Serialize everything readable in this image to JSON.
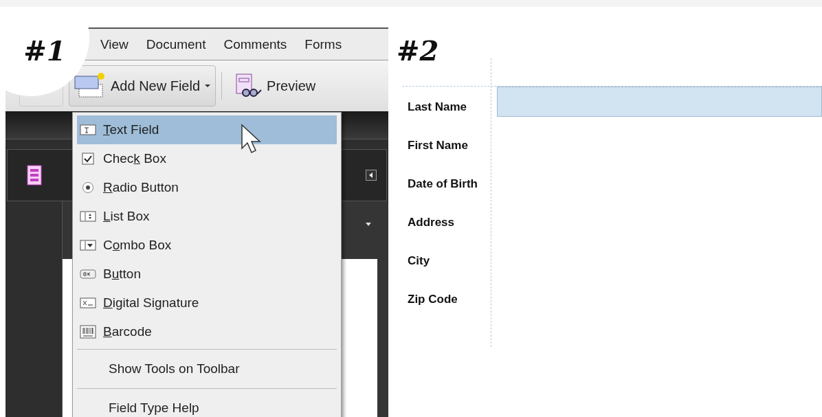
{
  "step1": {
    "badge": "#1",
    "menu_bar": [
      "View",
      "Document",
      "Comments",
      "Forms"
    ],
    "toolbar": {
      "add_field": "Add New Field",
      "preview": "Preview"
    },
    "dropdown": [
      {
        "kind": "text",
        "label": {
          "key": "T",
          "after": "ext Field"
        },
        "selected": true
      },
      {
        "kind": "check",
        "label": {
          "before": "Chec",
          "key": "k",
          "after": " Box"
        },
        "selected": false
      },
      {
        "kind": "radio",
        "label": {
          "key": "R",
          "after": "adio Button"
        },
        "selected": false
      },
      {
        "kind": "list",
        "label": {
          "key": "L",
          "after": "ist Box"
        },
        "selected": false
      },
      {
        "kind": "combo",
        "label": {
          "before": "C",
          "key": "o",
          "after": "mbo Box"
        },
        "selected": false
      },
      {
        "kind": "ok",
        "label": {
          "before": "B",
          "key": "u",
          "after": "tton"
        },
        "selected": false
      },
      {
        "kind": "signature",
        "label": {
          "key": "D",
          "after": "igital Signature"
        },
        "selected": false
      },
      {
        "kind": "barcode",
        "label": {
          "key": "B",
          "after": "arcode"
        },
        "selected": false
      },
      {
        "kind": "command",
        "label": "Show Tools on Toolbar",
        "selected": false
      },
      {
        "kind": "command",
        "label": "Field Type Help",
        "selected": false
      }
    ]
  },
  "step2": {
    "badge": "#2",
    "fields": [
      {
        "label": "Last Name",
        "selected": true
      },
      {
        "label": "First Name",
        "selected": false
      },
      {
        "label": "Date of Birth",
        "selected": false
      },
      {
        "label": "Address",
        "selected": false
      },
      {
        "label": "City",
        "selected": false
      },
      {
        "label": "Zip Code",
        "selected": false
      }
    ]
  }
}
